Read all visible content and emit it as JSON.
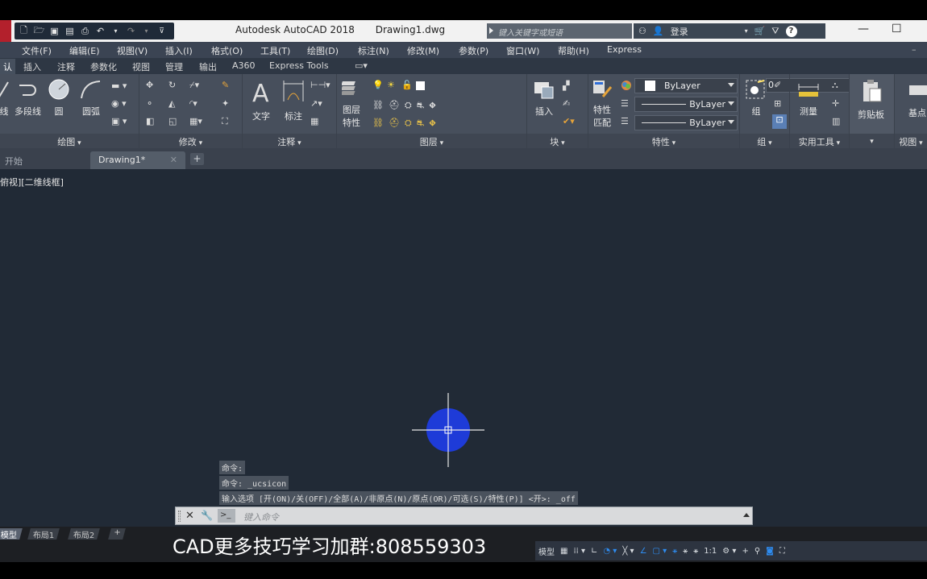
{
  "titlebar": {
    "app_title": "Autodesk AutoCAD 2018",
    "doc_title": "Drawing1.dwg",
    "search_placeholder": "键入关键字或短语",
    "login": "登录",
    "help": "?",
    "minimize": "—",
    "maximize": "☐"
  },
  "menubar": {
    "items": [
      "文件(F)",
      "编辑(E)",
      "视图(V)",
      "插入(I)",
      "格式(O)",
      "工具(T)",
      "绘图(D)",
      "标注(N)",
      "修改(M)",
      "参数(P)",
      "窗口(W)",
      "帮助(H)",
      "Express"
    ]
  },
  "ribbon_tabs": {
    "items": [
      "认",
      "插入",
      "注释",
      "参数化",
      "视图",
      "管理",
      "输出",
      "A360",
      "Express Tools"
    ]
  },
  "ribbon": {
    "draw": {
      "footer": "绘图",
      "line": "线",
      "polyline": "多段线",
      "circle": "圆",
      "arc": "圆弧"
    },
    "modify": {
      "footer": "修改"
    },
    "annotation": {
      "footer": "注释",
      "text": "文字",
      "dimension": "标注"
    },
    "layers": {
      "footer": "图层",
      "layer_props_1": "图层",
      "layer_props_2": "特性",
      "current_layer": "0"
    },
    "block": {
      "footer": "块",
      "insert": "插入"
    },
    "properties": {
      "footer": "特性",
      "match_1": "特性",
      "match_2": "匹配",
      "color": "ByLayer",
      "linetype": "ByLayer",
      "lineweight": "ByLayer"
    },
    "group": {
      "footer": "组",
      "group": "组"
    },
    "utilities": {
      "footer": "实用工具",
      "measure": "测量"
    },
    "clipboard": {
      "label": "剪贴板"
    },
    "view": {
      "footer": "视图",
      "base": "基点"
    }
  },
  "file_tabs": {
    "start": "开始",
    "drawing": "Drawing1*",
    "close": "✕",
    "add": "+"
  },
  "drawing": {
    "view_label": "俯视][二维线框]",
    "point_color": "#1e3bd8",
    "history": [
      "命令:",
      "命令: _ucsicon",
      "输入选项 [开(ON)/关(OFF)/全部(A)/非原点(N)/原点(OR)/可选(S)/特性(P)] <开>: _off"
    ],
    "command_placeholder": "键入命令",
    "prompt_icon": ">_"
  },
  "layout_tabs": {
    "items": [
      "模型",
      "布局1",
      "布局2"
    ],
    "add": "+"
  },
  "promo_text": "CAD更多技巧学习加群:808559303",
  "statusbar": {
    "model": "模型",
    "scale": "1:1"
  }
}
